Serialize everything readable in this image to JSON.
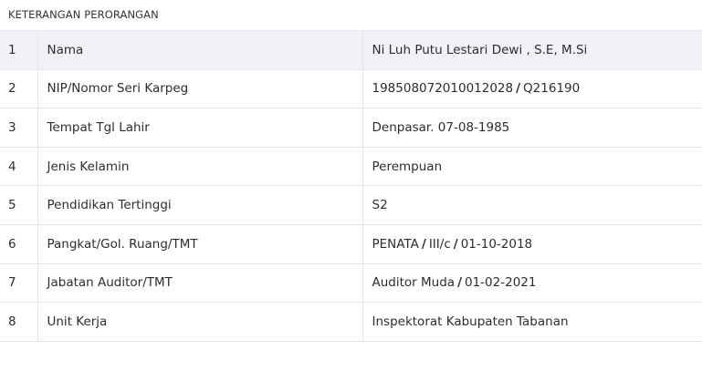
{
  "section": {
    "title": "KETERANGAN PERORANGAN"
  },
  "rows": [
    {
      "no": "1",
      "label": "Nama",
      "parts": [
        "Ni Luh Putu Lestari Dewi , S.E, M.Si"
      ]
    },
    {
      "no": "2",
      "label": "NIP/Nomor Seri Karpeg",
      "parts": [
        "198508072010012028",
        "Q216190"
      ]
    },
    {
      "no": "3",
      "label": "Tempat Tgl Lahir",
      "parts": [
        "Denpasar. 07-08-1985"
      ]
    },
    {
      "no": "4",
      "label": "Jenis Kelamin",
      "parts": [
        "Perempuan"
      ]
    },
    {
      "no": "5",
      "label": "Pendidikan Tertinggi",
      "parts": [
        "S2"
      ]
    },
    {
      "no": "6",
      "label": "Pangkat/Gol. Ruang/TMT",
      "parts": [
        "PENATA",
        "III/c",
        "01-10-2018"
      ]
    },
    {
      "no": "7",
      "label": "Jabatan Auditor/TMT",
      "parts": [
        "Auditor Muda",
        "01-02-2021"
      ]
    },
    {
      "no": "8",
      "label": "Unit Kerja",
      "parts": [
        "Inspektorat Kabupaten Tabanan"
      ]
    }
  ],
  "separator": "/"
}
